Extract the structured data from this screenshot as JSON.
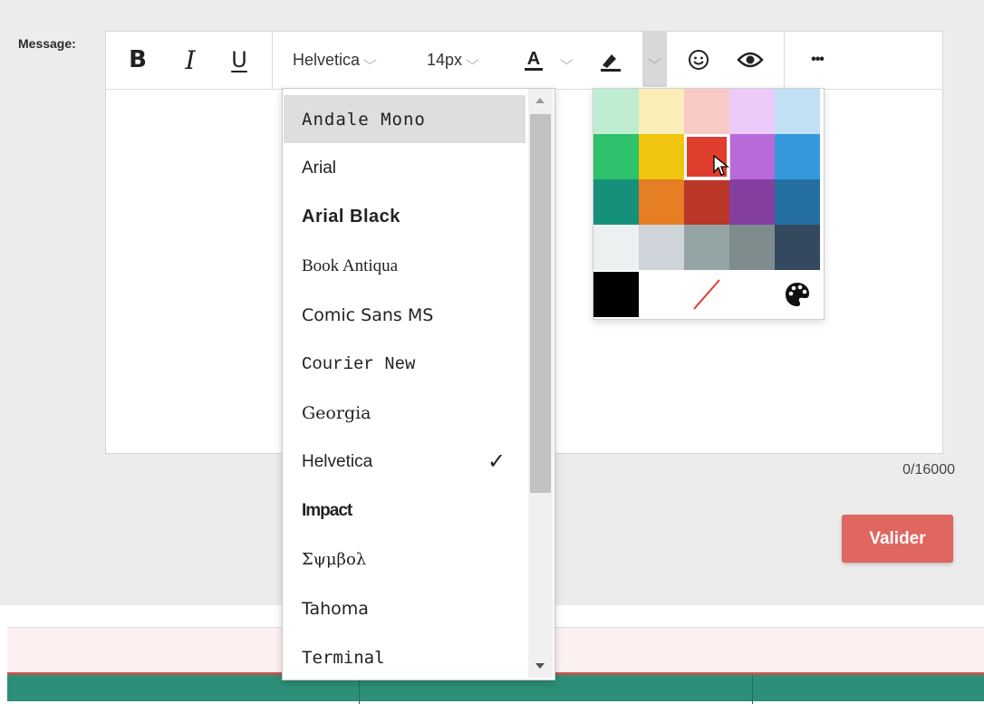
{
  "form": {
    "label": "Message:",
    "counter": "0/16000",
    "submit_label": "Valider"
  },
  "toolbar": {
    "bold": "B",
    "italic": "I",
    "underline": "U",
    "font_family": "Helvetica",
    "font_size": "14px",
    "text_color_glyph": "A",
    "more": "•••",
    "icons": [
      "bold-icon",
      "italic-icon",
      "underline-icon",
      "text-color-icon",
      "highlight-icon",
      "emoji-icon",
      "preview-eye-icon",
      "more-icon"
    ]
  },
  "font_menu": {
    "selected": "Helvetica",
    "check": "✓",
    "items": [
      {
        "label": "Andale Mono",
        "font": "DejaVu Sans Mono",
        "weight": "normal",
        "size": "19px",
        "spacing": "1px"
      },
      {
        "label": "Arial",
        "font": "Liberation Sans",
        "weight": "normal",
        "size": "19px",
        "spacing": "0"
      },
      {
        "label": "Arial Black",
        "font": "Liberation Sans",
        "weight": "bold",
        "size": "20px",
        "spacing": "0.5px"
      },
      {
        "label": "Book Antiqua",
        "font": "Liberation Serif",
        "weight": "normal",
        "size": "19px",
        "spacing": "0"
      },
      {
        "label": "Comic Sans MS",
        "font": "DejaVu Sans",
        "weight": "normal",
        "size": "19px",
        "spacing": "0"
      },
      {
        "label": "Courier New",
        "font": "Liberation Mono",
        "weight": "normal",
        "size": "19px",
        "spacing": "0"
      },
      {
        "label": "Georgia",
        "font": "DejaVu Serif",
        "weight": "normal",
        "size": "19px",
        "spacing": "0"
      },
      {
        "label": "Helvetica",
        "font": "Liberation Sans",
        "weight": "normal",
        "size": "19px",
        "spacing": "0"
      },
      {
        "label": "Impact",
        "font": "Liberation Sans",
        "weight": "bold",
        "size": "19px",
        "spacing": "-1px"
      },
      {
        "label": "Σψμβολ",
        "font": "DejaVu Serif",
        "weight": "normal",
        "size": "18px",
        "spacing": "0"
      },
      {
        "label": "Tahoma",
        "font": "DejaVu Sans",
        "weight": "normal",
        "size": "19px",
        "spacing": "0"
      },
      {
        "label": "Terminal",
        "font": "DejaVu Sans Mono",
        "weight": "normal",
        "size": "19px",
        "spacing": "0"
      }
    ]
  },
  "color_picker": {
    "selected": "#e03e2d",
    "rows": [
      [
        "#bfedd2",
        "#fbeeb8",
        "#f8cac6",
        "#eccafa",
        "#c2e0f4"
      ],
      [
        "#2dc26b",
        "#f1c40f",
        "#e03e2d",
        "#b96ad9",
        "#3598db"
      ],
      [
        "#169179",
        "#e67e23",
        "#ba372a",
        "#843fa1",
        "#236fa1"
      ],
      [
        "#ecf0f1",
        "#ced4d9",
        "#95a5a6",
        "#7e8c8d",
        "#34495e"
      ]
    ],
    "black": "#000000",
    "remove_color_icon": "remove-color-icon",
    "custom_color_icon": "palette-icon"
  },
  "colors": {
    "accent": "#e06660",
    "footer": "#2e8f78",
    "footer_border": "#c4564d"
  }
}
